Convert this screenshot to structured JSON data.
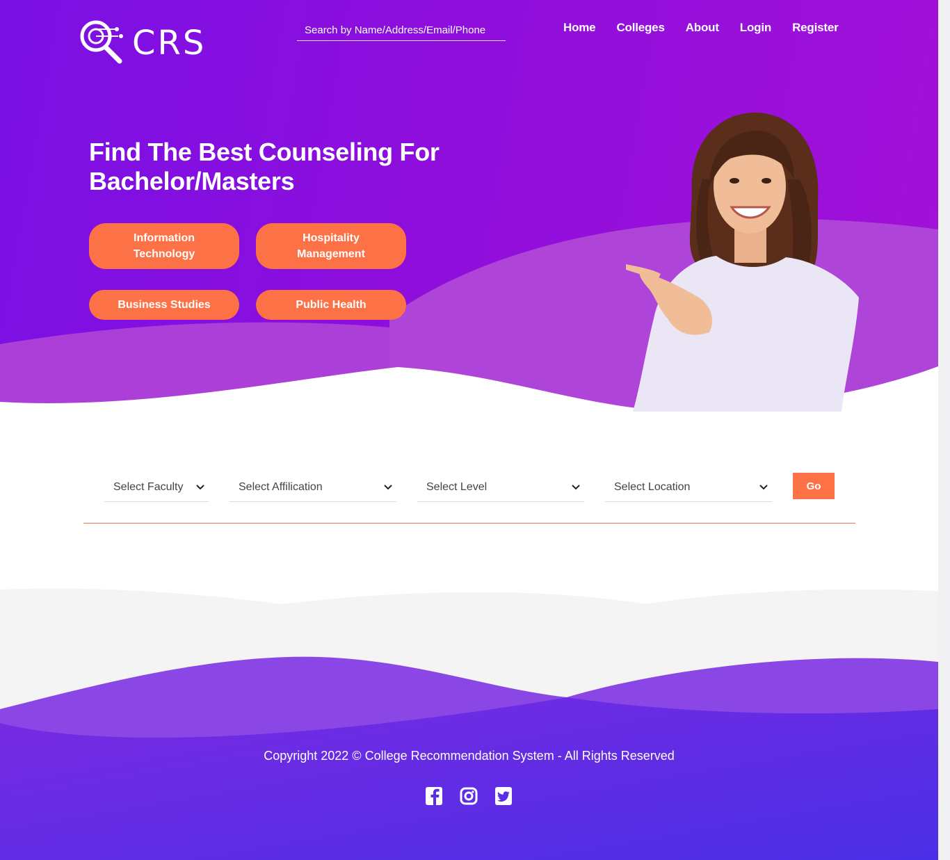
{
  "header": {
    "brand": "CRS",
    "search_placeholder": "Search by Name/Address/Email/Phone",
    "nav": [
      "Home",
      "Colleges",
      "About",
      "Login",
      "Register"
    ]
  },
  "hero": {
    "headline_line1": "Find The Best Counseling For",
    "headline_line2": "Bachelor/Masters",
    "categories": [
      {
        "line1": "Information",
        "line2": "Technology"
      },
      {
        "line1": "Hospitality",
        "line2": "Management"
      },
      {
        "line1": "Business Studies"
      },
      {
        "line1": "Public Health"
      }
    ]
  },
  "filters": {
    "faculty": "Select Faculty",
    "affiliation": "Select Affilication",
    "level": "Select Level",
    "location": "Select Location",
    "go_label": "Go"
  },
  "footer": {
    "copyright": "Copyright 2022 © College Recommendation System - All Rights Reserved",
    "social_icons": [
      "facebook-icon",
      "instagram-icon",
      "twitter-icon"
    ]
  },
  "colors": {
    "hero_start": "#7a10e4",
    "hero_end": "#a211d8",
    "accent_orange": "#fc7145",
    "footer_purple": "#5a2ee8"
  }
}
